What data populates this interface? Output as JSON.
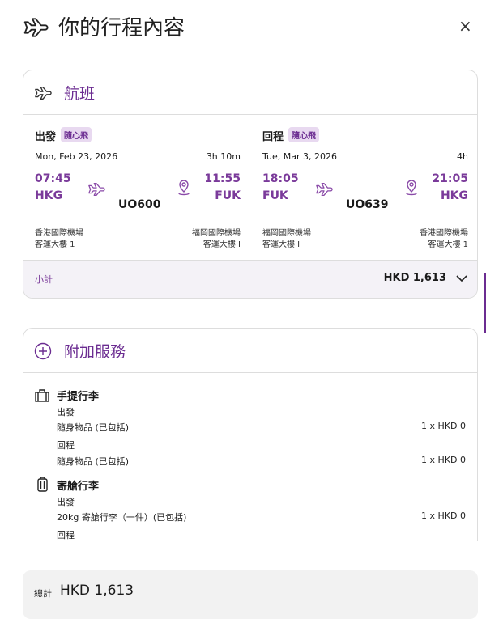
{
  "header": {
    "title": "你的行程內容",
    "icon": "airplane-icon",
    "close_icon": "close-icon",
    "close_label": "×"
  },
  "colors": {
    "accent": "#6b2c91",
    "badge_bg": "#e8d9f0",
    "subtotal_bg": "#f4f2f7"
  },
  "flights": {
    "title": "航班",
    "legs": [
      {
        "label": "出發",
        "badge": "隨心飛",
        "date": "Mon, Feb 23, 2026",
        "duration": "3h 10m",
        "dep_time": "07:45",
        "dep_code": "HKG",
        "arr_time": "11:55",
        "arr_code": "FUK",
        "flight_no": "UO600",
        "dep_airport": "香港國際機場",
        "dep_terminal": "客運大樓 1",
        "arr_airport": "福岡國際機場",
        "arr_terminal": "客運大樓 I"
      },
      {
        "label": "回程",
        "badge": "隨心飛",
        "date": "Tue, Mar 3, 2026",
        "duration": "4h",
        "dep_time": "18:05",
        "dep_code": "FUK",
        "arr_time": "21:05",
        "arr_code": "HKG",
        "flight_no": "UO639",
        "dep_airport": "福岡國際機場",
        "dep_terminal": "客運大樓 I",
        "arr_airport": "香港國際機場",
        "arr_terminal": "客運大樓 1"
      }
    ],
    "subtotal_label": "小計",
    "subtotal_value": "HKD 1,613"
  },
  "addons": {
    "title": "附加服務",
    "carry_on": {
      "title": "手提行李",
      "items": [
        {
          "leg": "出發",
          "name": "隨身物品 (已包括)",
          "price": "1 x HKD 0"
        },
        {
          "leg": "回程",
          "name": "隨身物品 (已包括)",
          "price": "1 x HKD 0"
        }
      ]
    },
    "checked": {
      "title": "寄艙行李",
      "items": [
        {
          "leg": "出發",
          "name": "20kg 寄艙行李（一件）(已包括)",
          "price": "1 x HKD 0"
        },
        {
          "leg": "回程"
        }
      ]
    }
  },
  "total": {
    "label": "總計",
    "value": "HKD 1,613"
  }
}
